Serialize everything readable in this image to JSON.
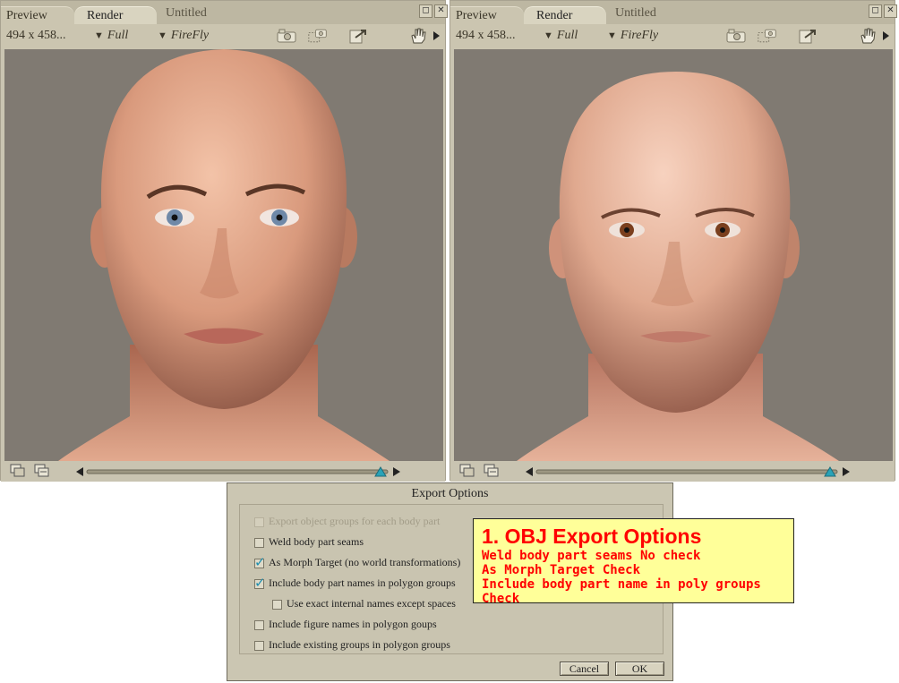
{
  "windows": [
    {
      "tabs": [
        "Preview",
        "Render",
        "Untitled"
      ],
      "size": "494 x 458...",
      "quality": "Full",
      "renderer": "FireFly",
      "eye_color": "#6f89a8",
      "icons": [
        "camera-icon",
        "area-render-icon",
        "export-render-icon",
        "hand-icon",
        "play-arrow-icon"
      ]
    },
    {
      "tabs": [
        "Preview",
        "Render",
        "Untitled"
      ],
      "size": "494 x 458...",
      "quality": "Full",
      "renderer": "FireFly",
      "eye_color": "#7a3f1e",
      "icons": [
        "camera-icon",
        "area-render-icon",
        "export-render-icon",
        "hand-icon",
        "play-arrow-icon"
      ]
    }
  ],
  "dialog": {
    "title": "Export Options",
    "options": [
      {
        "label": "Export object groups for each body part",
        "checked": false,
        "enabled": false
      },
      {
        "label": "Weld body part seams",
        "checked": false,
        "enabled": true
      },
      {
        "label": "As Morph Target (no world transformations)",
        "checked": true,
        "enabled": true
      },
      {
        "label": "Include body part names in polygon groups",
        "checked": true,
        "enabled": true
      },
      {
        "label": "Use exact internal names except spaces",
        "checked": false,
        "enabled": true
      },
      {
        "label": "Include figure names in polygon goups",
        "checked": false,
        "enabled": true
      },
      {
        "label": "Include existing groups in polygon groups",
        "checked": false,
        "enabled": true
      }
    ],
    "cancel_label": "Cancel",
    "ok_label": "OK"
  },
  "annotation": {
    "heading": "1. OBJ Export Options",
    "lines": [
      "Weld body part seams No check",
      "As Morph Target Check",
      "Include body part name in poly groups Check"
    ]
  },
  "colors": {
    "panel": "#c9c4b1",
    "viewport": "#807a72",
    "note_bg": "#ffff99",
    "note_text": "#ff0000",
    "check": "#1f8fb0"
  }
}
